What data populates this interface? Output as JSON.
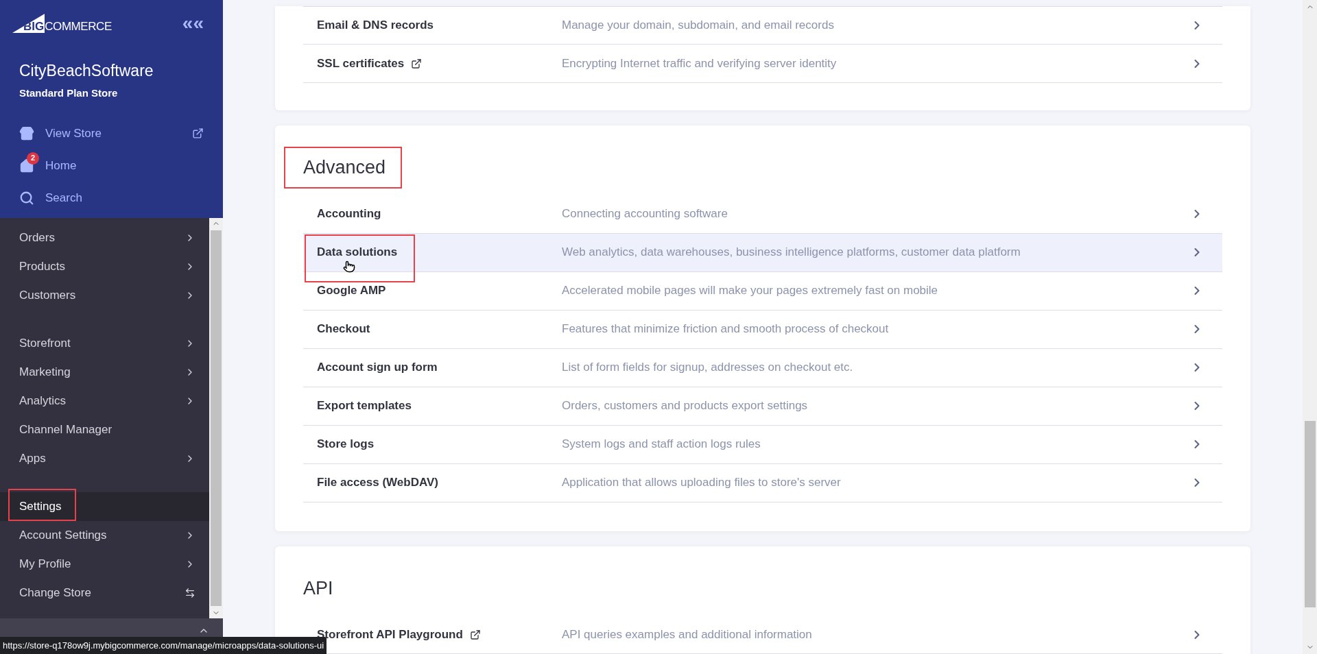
{
  "sidebar": {
    "logo": {
      "mark": "BIG",
      "word": "COMMERCE"
    },
    "collapse": "«",
    "store_name": "CityBeachSoftware",
    "plan": "Standard Plan Store",
    "top_links": [
      {
        "kind": "store",
        "label": "View Store",
        "external": true
      },
      {
        "kind": "home",
        "label": "Home",
        "badge": "2"
      },
      {
        "kind": "search",
        "label": "Search"
      }
    ],
    "nav_groups": [
      [
        {
          "label": "Orders",
          "kind": "submenu",
          "selected": false
        },
        {
          "label": "Products",
          "kind": "submenu",
          "selected": false
        },
        {
          "label": "Customers",
          "kind": "submenu",
          "selected": false
        }
      ],
      [
        {
          "label": "Storefront",
          "kind": "submenu",
          "selected": false
        },
        {
          "label": "Marketing",
          "kind": "submenu",
          "selected": false
        },
        {
          "label": "Analytics",
          "kind": "submenu",
          "selected": false
        },
        {
          "label": "Channel Manager",
          "kind": "link",
          "selected": false
        },
        {
          "label": "Apps",
          "kind": "submenu",
          "selected": false
        }
      ],
      [
        {
          "label": "Settings",
          "kind": "link",
          "selected": true,
          "annotated": true
        },
        {
          "label": "Account Settings",
          "kind": "submenu",
          "selected": false
        },
        {
          "label": "My Profile",
          "kind": "submenu",
          "selected": false
        },
        {
          "label": "Change Store",
          "kind": "switch",
          "selected": false
        }
      ]
    ]
  },
  "cards": [
    {
      "rows": [
        {
          "label": "Email & DNS records",
          "description": "Manage your domain, subdomain, and email records",
          "selected": false
        },
        {
          "label": "SSL certificates",
          "description": "Encrypting Internet traffic and verifying server identity",
          "external": true,
          "selected": false
        }
      ]
    },
    {
      "title": "Advanced",
      "title_annotated": true,
      "rows": [
        {
          "label": "Accounting",
          "description": "Connecting accounting software",
          "selected": false
        },
        {
          "label": "Data solutions",
          "description": "Web analytics, data warehouses, business intelligence platforms, customer data platform",
          "selected": true,
          "annotated": true
        },
        {
          "label": "Google AMP",
          "description": "Accelerated mobile pages will make your pages extremely fast on mobile",
          "selected": false
        },
        {
          "label": "Checkout",
          "description": "Features that minimize friction and smooth process of checkout",
          "selected": false
        },
        {
          "label": "Account sign up form",
          "description": "List of form fields for signup, addresses on checkout etc.",
          "selected": false
        },
        {
          "label": "Export templates",
          "description": "Orders, customers and products export settings",
          "selected": false
        },
        {
          "label": "Store logs",
          "description": "System logs and staff action logs rules",
          "selected": false
        },
        {
          "label": "File access (WebDAV)",
          "description": "Application that allows uploading files to store's server",
          "selected": false
        }
      ]
    },
    {
      "title": "API",
      "title_annotated": false,
      "rows": [
        {
          "label": "Storefront API Playground",
          "description": "API queries examples and additional information",
          "external": true,
          "selected": false
        }
      ]
    }
  ],
  "status_bar": {
    "url": "https://store-q178ow9j.mybigcommerce.com/manage/microapps/data-solutions-ui"
  }
}
